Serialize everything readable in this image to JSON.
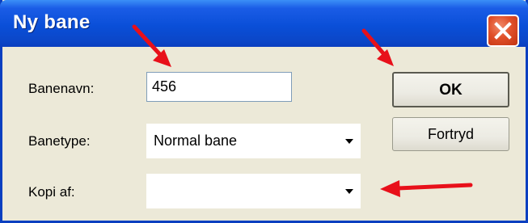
{
  "window": {
    "title": "Ny bane"
  },
  "form": {
    "name_label": "Banenavn:",
    "name_value": "456",
    "type_label": "Banetype:",
    "type_value": "Normal bane",
    "copy_label": "Kopi af:",
    "copy_value": ""
  },
  "buttons": {
    "ok_label": "OK",
    "cancel_label": "Fortryd"
  },
  "icons": {
    "close": "close-icon",
    "dropdown": "dropdown-arrow-icon",
    "annotation": "red-arrow-icon"
  },
  "colors": {
    "titlebar": "#0a4fd8",
    "close_button": "#e0502a",
    "dialog_bg": "#ece9d8",
    "annotation_arrow": "#e8101a"
  }
}
